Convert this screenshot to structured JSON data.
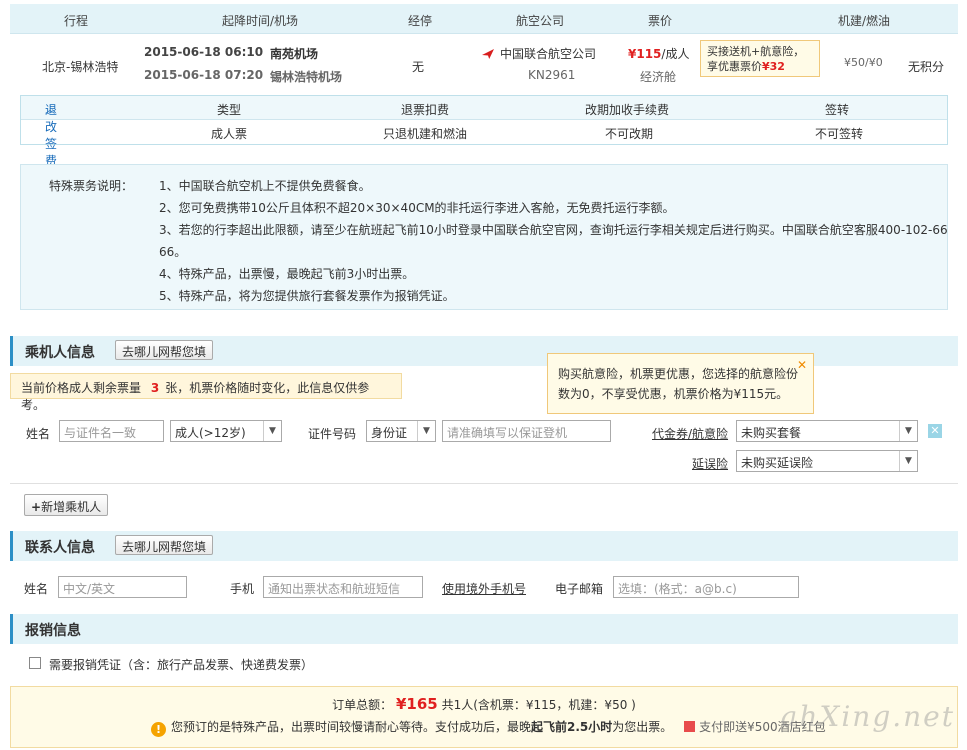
{
  "header": {
    "itinerary": "行程",
    "time_airport": "起降时间/机场",
    "stops": "经停",
    "airline": "航空公司",
    "price": "票价",
    "tax": "机建/燃油"
  },
  "flight": {
    "route": "北京-锡林浩特",
    "dep_date_time": "2015-06-18  06:10",
    "dep_airport": "南苑机场",
    "arr_date_time": "2015-06-18  07:20",
    "arr_airport": "锡林浩特机场",
    "stops": "无",
    "airline_name": "中国联合航空公司",
    "flight_no": "KN2961",
    "price": "¥115",
    "price_unit": "/成人",
    "cabin": "经济舱",
    "promo_line1": "买接送机+航意险，",
    "promo_line2": "享优惠票价",
    "promo_price": "¥32",
    "tax": "¥50/¥0",
    "points": "无积分"
  },
  "refund": {
    "link": "退改签费用标准",
    "col_type": "类型",
    "col_refund": "退票扣费",
    "col_change": "改期加收手续费",
    "col_transfer": "签转",
    "type": "成人票",
    "refund": "只退机建和燃油",
    "change": "不可改期",
    "transfer": "不可签转"
  },
  "notes": {
    "label": "特殊票务说明：",
    "lines": [
      "1、中国联合航空机上不提供免费餐食。",
      "2、您可免费携带10公斤且体积不超20×30×40CM的非托运行李进入客舱，无免费托运行李额。",
      "3、若您的行李超出此限额，请至少在航班起飞前10小时登录中国联合航空官网，查询托运行李相关规定后进行购买。中国联合航空客服400-102-66",
      "66。",
      "4、特殊产品，出票慢，最晚起飞前3小时出票。",
      "5、特殊产品，将为您提供旅行套餐发票作为报销凭证。"
    ]
  },
  "passenger": {
    "title": "乘机人信息",
    "fill_button": "去哪儿网帮您填",
    "warn_pre": "当前价格成人剩余票量",
    "warn_count": "3",
    "warn_post": "张，机票价格随时变化，此信息仅供参考。",
    "tip": "购买航意险，机票更优惠，您选择的航意险份数为0，不享受优惠，机票价格为¥115元。",
    "name_label": "姓名",
    "name_placeholder": "与证件名一致",
    "type_value": "成人(>12岁)",
    "id_label": "证件号码",
    "id_type": "身份证",
    "id_placeholder": "请准确填写以保证登机",
    "insurance_link": "代金券/航意险",
    "insurance_value": "未购买套餐",
    "delay_link": "延误险",
    "delay_value": "未购买延误险",
    "add_button": "新增乘机人"
  },
  "contact": {
    "title": "联系人信息",
    "fill_button": "去哪儿网帮您填",
    "name_label": "姓名",
    "name_placeholder": "中文/英文",
    "phone_label": "手机",
    "phone_placeholder": "通知出票状态和航班短信",
    "other_phone_link": "使用境外手机号",
    "email_label": "电子邮箱",
    "email_placeholder": "选填：(格式：a@b.c)"
  },
  "reimburse": {
    "title": "报销信息",
    "checkbox_label": "需要报销凭证（含：旅行产品发票、快递费发票）"
  },
  "footer": {
    "total_label": "订单总额：",
    "total": "¥165",
    "total_detail": "共1人(含机票：¥115，机建：¥50 )",
    "notice_pre": "您预订的是特殊产品，出票时间较慢请耐心等待。支付成功后，最晚",
    "notice_bold": "起飞前2.5小时",
    "notice_post": "为您出票。",
    "gift": "支付即送¥500酒店红包"
  },
  "watermark": "ahXing.net"
}
